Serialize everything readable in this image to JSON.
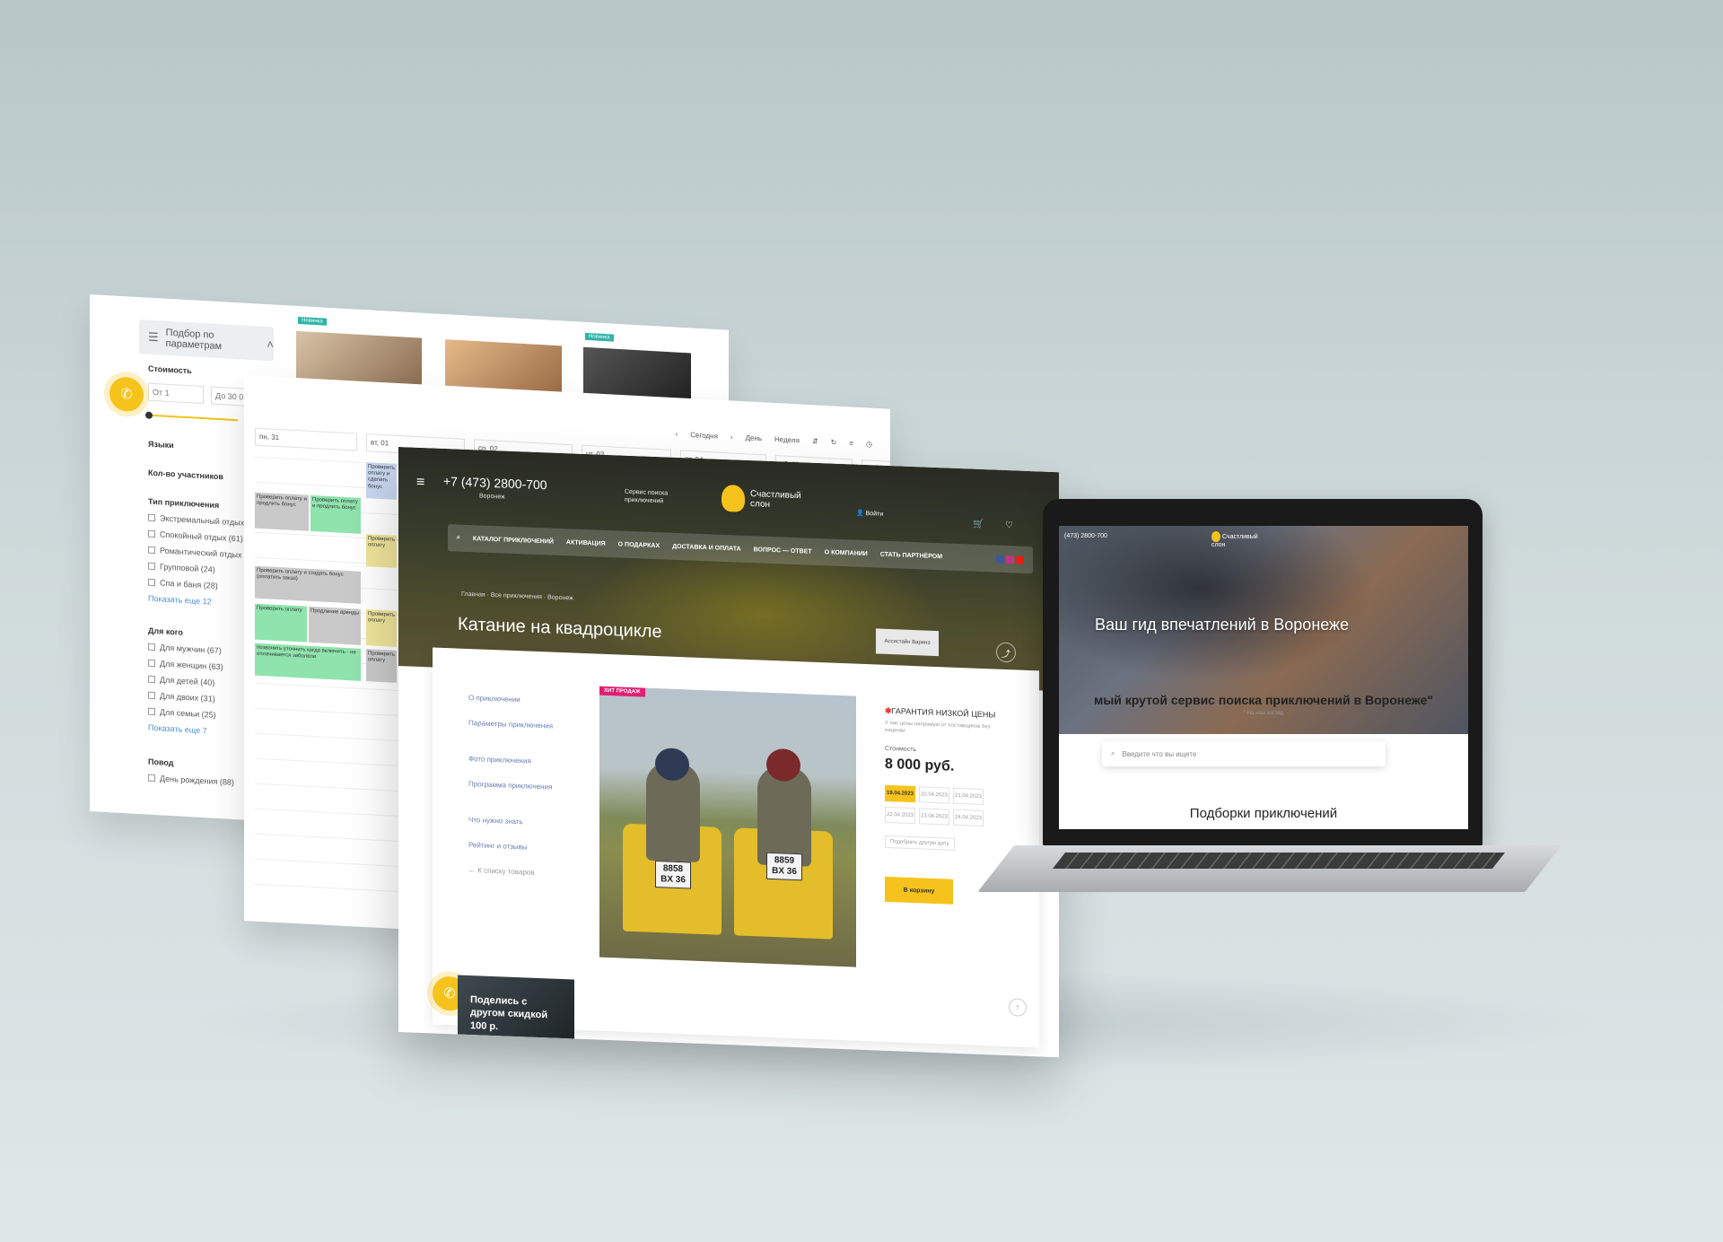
{
  "filter_panel": {
    "header": "Подбор по параметрам",
    "cost_label": "Стоимость",
    "from_placeholder": "От 1",
    "to_placeholder": "До 30 0",
    "languages_label": "Языки",
    "participants_label": "Кол-во участников",
    "type_label": "Тип приключения",
    "types": [
      "Экстремальный отдых",
      "Спокойный отдых (61)",
      "Романтический отдых",
      "Групповой (24)",
      "Спа и баня (28)"
    ],
    "show_more_1": "Показать еще 12",
    "for_whom_label": "Для кого",
    "for_whom": [
      "Для мужчин (67)",
      "Для женщин (63)",
      "Для детей (40)",
      "Для двоих (31)",
      "Для семьи (25)"
    ],
    "show_more_2": "Показать еще 7",
    "occasion_label": "Повод",
    "occasion_first": "День рождения (88)",
    "badge": "Новинка"
  },
  "calendar_panel": {
    "toolbar": [
      "Сегодня",
      "День",
      "Неделя"
    ],
    "days": [
      "пн, 31",
      "вт, 01",
      "ср, 02",
      "чт, 03",
      "пт, 04",
      "сб, 05",
      "вс, 06"
    ],
    "events": [
      "Проверить оплату и сделать бонус",
      "Проверить оплату и продлить бонус",
      "Проверить оплату и создать бонус (оплатить заказ)",
      "Проверить оплату и продлить бонус",
      "Продление аренды",
      "позвонить уточнить когда включить - не оплачивается заболели",
      "Проверить оплату",
      "Проверить оплату",
      "Проверить оплату",
      "Проверить оплату"
    ]
  },
  "main_page": {
    "phone": "+7 (473) 2800-700",
    "city": "Воронеж",
    "service_tagline": "Сервис поиска приключений",
    "logo_text": "Счастливый слон",
    "login": "Войти",
    "nav": [
      "КАТАЛОГ ПРИКЛЮЧЕНИЙ",
      "АКТИВАЦИЯ",
      "О ПОДАРКАХ",
      "ДОСТАВКА И ОПЛАТА",
      "ВОПРОС — ОТВЕТ",
      "О КОМПАНИИ",
      "СТАТЬ ПАРТНЁРОМ"
    ],
    "breadcrumb": "Главная · Все приключения · Воронеж",
    "title": "Катание на квадроцикле",
    "ghost_button": "Ассистайн Варинэ",
    "sidebar": [
      "О приключении",
      "Параметры приключения",
      "Фото приключения",
      "Программа приключения",
      "Что нужно знать",
      "Рейтинг и отзывы",
      "← К списку товаров"
    ],
    "sale_badge": "ХИТ ПРОДАЖ",
    "guarantee": "ГАРАНТИЯ НИЗКОЙ ЦЕНЫ",
    "guarantee_sub": "У нас цены напрямую от поставщиков без наценки",
    "price_label": "Стоимость",
    "price": "8 000 руб.",
    "dates": [
      "19.04.2023",
      "20.04.2023",
      "21.04.2023",
      "22.04.2023",
      "23.04.2023",
      "24.04.2023"
    ],
    "pick_date": "Подобрать другую дату",
    "cart_button": "В корзину",
    "plates": [
      [
        "8858",
        "BX 36"
      ],
      [
        "8859",
        "BX 36"
      ]
    ],
    "promo": "Поделись с другом скидкой 100 р."
  },
  "laptop": {
    "phone": "(473) 2800-700",
    "logo_text": "Счастливый слон",
    "hero_title": "Ваш гид впечатлений в Воронеже",
    "subtitle": "мый крутой сервис поиска приключений в Воронеже\"",
    "note": "* На наш взгляд",
    "search_placeholder": "Введите что вы ищете",
    "section_title": "Подборки приключений"
  },
  "colors": {
    "accent": "#f6c31c",
    "sale": "#e11d74",
    "link": "#6b7fb8",
    "event_green": "#8fe3ad"
  }
}
